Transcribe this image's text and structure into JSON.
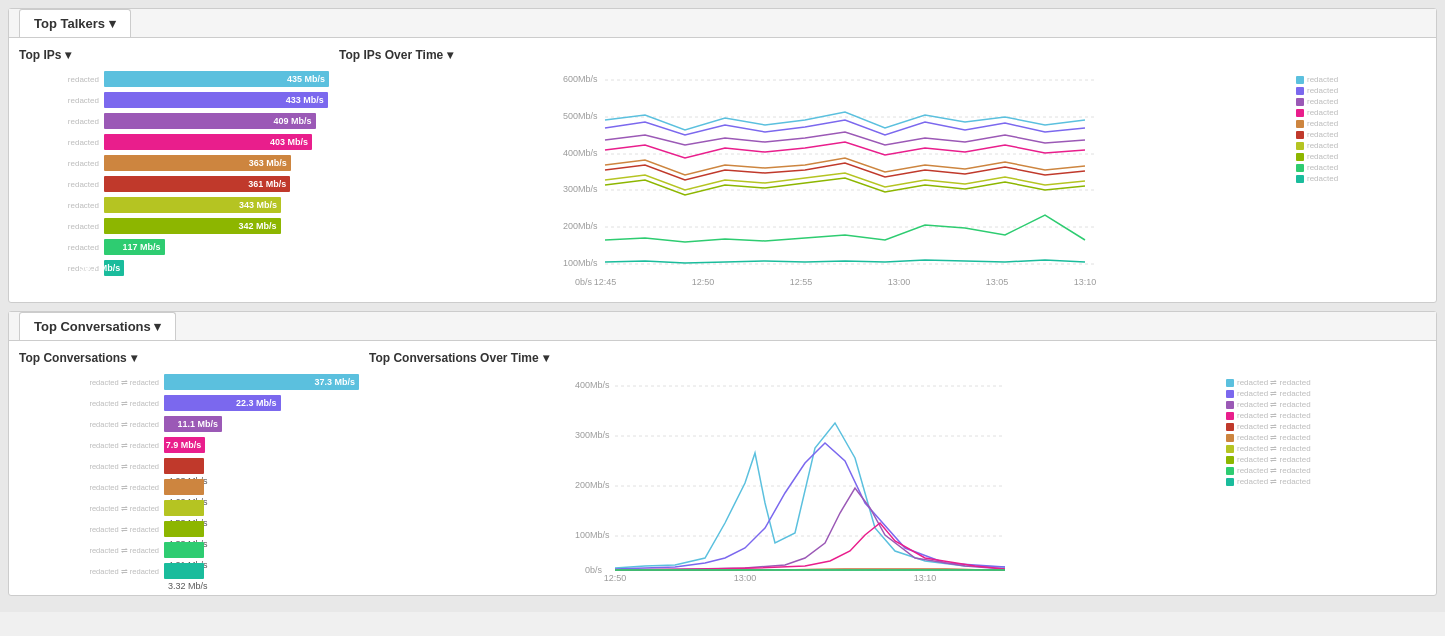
{
  "topTalkers": {
    "title": "Top Talkers",
    "topIPs": {
      "title": "Top IPs",
      "bars": [
        {
          "label": "redacted",
          "value": "435 Mb/s",
          "width": 100,
          "color": "#5bc0de"
        },
        {
          "label": "redacted",
          "value": "433 Mb/s",
          "width": 99.5,
          "color": "#7b68ee"
        },
        {
          "label": "redacted",
          "value": "409 Mb/s",
          "width": 94,
          "color": "#9b59b6"
        },
        {
          "label": "redacted",
          "value": "403 Mb/s",
          "width": 92.5,
          "color": "#e91e8c"
        },
        {
          "label": "redacted",
          "value": "363 Mb/s",
          "width": 83,
          "color": "#cd853f"
        },
        {
          "label": "redacted",
          "value": "361 Mb/s",
          "width": 82.8,
          "color": "#c0392b"
        },
        {
          "label": "redacted",
          "value": "343 Mb/s",
          "width": 78.7,
          "color": "#b5c422"
        },
        {
          "label": "redacted",
          "value": "342 Mb/s",
          "width": 78.5,
          "color": "#8db600"
        },
        {
          "label": "redacted",
          "value": "117 Mb/s",
          "width": 26.9,
          "color": "#2ecc71"
        },
        {
          "label": "redacted",
          "value": "39.7 Mb/s",
          "width": 9,
          "color": "#1abc9c"
        }
      ]
    },
    "topIPsOverTime": {
      "title": "Top IPs Over Time",
      "yLabels": [
        "600Mb/s",
        "500Mb/s",
        "400Mb/s",
        "300Mb/s",
        "200Mb/s",
        "100Mb/s",
        "0b/s"
      ],
      "xLabels": [
        "12:45",
        "12:50",
        "12:55",
        "13:00",
        "13:05",
        "13:10"
      ],
      "legend": [
        {
          "color": "#5bc0de",
          "label": "redacted"
        },
        {
          "color": "#7b68ee",
          "label": "redacted"
        },
        {
          "color": "#9b59b6",
          "label": "redacted"
        },
        {
          "color": "#e91e8c",
          "label": "redacted"
        },
        {
          "color": "#cd853f",
          "label": "redacted"
        },
        {
          "color": "#c0392b",
          "label": "redacted"
        },
        {
          "color": "#b5c422",
          "label": "redacted"
        },
        {
          "color": "#8db600",
          "label": "redacted"
        },
        {
          "color": "#2ecc71",
          "label": "redacted"
        },
        {
          "color": "#1abc9c",
          "label": "redacted"
        }
      ]
    }
  },
  "topConversations": {
    "title": "Top Conversations",
    "topConv": {
      "title": "Top Conversations",
      "bars": [
        {
          "label": "redacted ⇌ redacted",
          "value": "37.3 Mb/s",
          "width": 100,
          "color": "#5bc0de",
          "bold": true
        },
        {
          "label": "redacted ⇌ redacted",
          "value": "22.3 Mb/s",
          "width": 59.8,
          "color": "#7b68ee",
          "bold": true
        },
        {
          "label": "redacted ⇌ redacted",
          "value": "11.1 Mb/s",
          "width": 29.8,
          "color": "#9b59b6",
          "bold": true
        },
        {
          "label": "redacted ⇌ redacted",
          "value": "7.9 Mb/s",
          "width": 21.2,
          "color": "#e91e8c",
          "bold": true
        },
        {
          "label": "redacted ⇌ redacted",
          "value": "4.93 Mb/s",
          "width": 13.2,
          "color": "#c0392b"
        },
        {
          "label": "redacted ⇌ redacted",
          "value": "4.62 Mb/s",
          "width": 12.4,
          "color": "#cd853f"
        },
        {
          "label": "redacted ⇌ redacted",
          "value": "4.53 Mb/s",
          "width": 12.1,
          "color": "#b5c422"
        },
        {
          "label": "redacted ⇌ redacted",
          "value": "4.33 Mb/s",
          "width": 11.6,
          "color": "#8db600"
        },
        {
          "label": "redacted ⇌ redacted",
          "value": "4.21 Mb/s",
          "width": 11.3,
          "color": "#2ecc71"
        },
        {
          "label": "redacted ⇌ redacted",
          "value": "3.32 Mb/s",
          "width": 8.9,
          "color": "#1abc9c"
        }
      ]
    },
    "topConvOverTime": {
      "title": "Top Conversations Over Time",
      "yLabels": [
        "400Mb/s",
        "300Mb/s",
        "200Mb/s",
        "100Mb/s",
        "0b/s"
      ],
      "xLabels": [
        "12:50",
        "13:00",
        "13:10"
      ],
      "legend": [
        {
          "color": "#5bc0de",
          "label": "redacted ⇌ redacted"
        },
        {
          "color": "#7b68ee",
          "label": "redacted ⇌ redacted"
        },
        {
          "color": "#9b59b6",
          "label": "redacted ⇌ redacted"
        },
        {
          "color": "#e91e8c",
          "label": "redacted ⇌ redacted"
        },
        {
          "color": "#c0392b",
          "label": "redacted ⇌ redacted"
        },
        {
          "color": "#cd853f",
          "label": "redacted ⇌ redacted"
        },
        {
          "color": "#b5c422",
          "label": "redacted ⇌ redacted"
        },
        {
          "color": "#8db600",
          "label": "redacted ⇌ redacted"
        },
        {
          "color": "#2ecc71",
          "label": "redacted ⇌ redacted"
        },
        {
          "color": "#1abc9c",
          "label": "redacted ⇌ redacted"
        }
      ]
    }
  },
  "labels": {
    "topTalkers": "Top Talkers",
    "topIPs": "Top IPs",
    "topIPsOverTime": "Top IPs Over Time",
    "topConversations": "Top Conversations",
    "topConvTitle": "Top Conversations",
    "topConvOverTime": "Top Conversations Over Time",
    "chevron": "▾"
  }
}
